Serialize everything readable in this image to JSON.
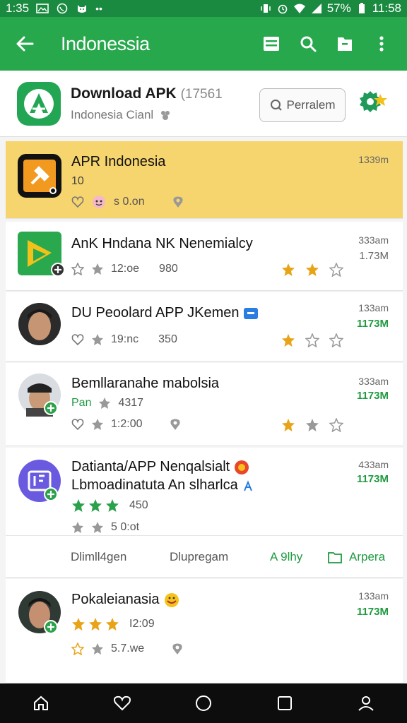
{
  "status_bar": {
    "time_left": "1:35",
    "battery": "57%",
    "time_right": "11:58"
  },
  "app_bar": {
    "title": "Indonessia"
  },
  "header": {
    "title": "Download APK",
    "version": "(17561",
    "subtitle": "Indonesia Cianl",
    "button_label": "Perralem"
  },
  "rows": [
    {
      "title": "APR Indonesia",
      "sub": "10",
      "meta_text": "s 0.on",
      "time": "1339m",
      "size": ""
    },
    {
      "title": "AnK Hndana NK Nenemialcy",
      "meta1": "12:oe",
      "meta2": "980",
      "time": "333am",
      "size": "1.73M"
    },
    {
      "title": "DU Peoolard APP JKemen",
      "meta1": "19:nc",
      "meta2": "350",
      "time": "133am",
      "size": "1173M"
    },
    {
      "title": "Bemllaranahe mabolsia",
      "sub": "Pan",
      "sub2": "4317",
      "meta1": "1:2:00",
      "time": "333am",
      "size": "1173M"
    },
    {
      "title": "Datianta/APP Nenqalsialt",
      "title2": "Lbmoadinatuta An slharlca",
      "rating": "450",
      "meta1": "5 0:ot",
      "time": "433am",
      "size": "1173M",
      "actions": [
        "Dlimll4gen",
        "Dlupregam",
        "A 9lhy",
        "Arpera"
      ]
    },
    {
      "title": "Pokaleianasia",
      "rating": "I2:09",
      "meta1": "5.7.we",
      "time": "133am",
      "size": "1173M"
    }
  ],
  "colors": {
    "primary": "#27a84d",
    "status": "#1a8a40",
    "highlight": "#f6d46e",
    "star": "#e8a317",
    "green_star": "#2aa14a"
  }
}
